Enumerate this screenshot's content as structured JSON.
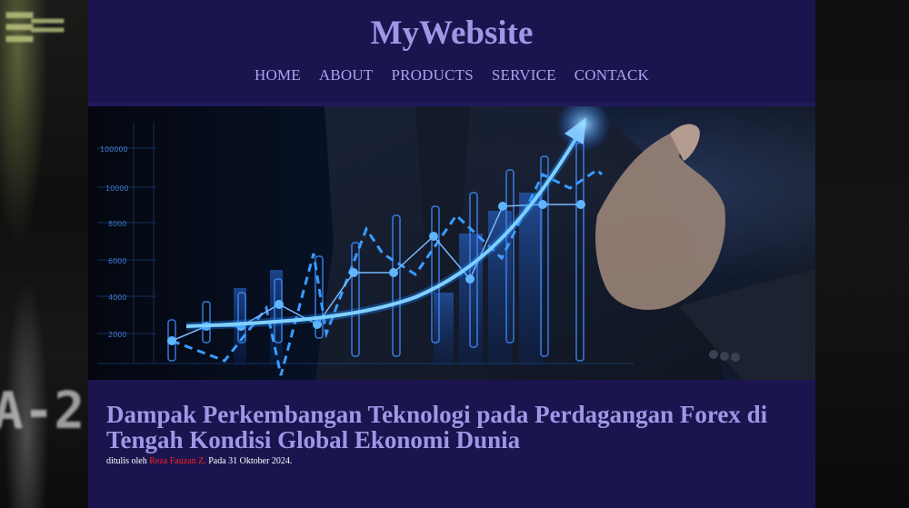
{
  "site": {
    "title": "MyWebsite"
  },
  "nav": {
    "items": [
      {
        "label": "HOME"
      },
      {
        "label": "ABOUT"
      },
      {
        "label": "PRODUCTS"
      },
      {
        "label": "SERVICE"
      },
      {
        "label": "CONTACK"
      }
    ]
  },
  "hero": {
    "description": "Businessman touching glowing rising chart",
    "axis_labels": [
      "100000",
      "10000",
      "8000",
      "6000",
      "4000",
      "2000"
    ]
  },
  "article": {
    "title": "Dampak Perkembangan Teknologi pada Perdagangan Forex di Tengah Kondisi Global Ekonomi Dunia",
    "byline_prefix": "ditulis oleh",
    "author": "Reza Fauzan Z.",
    "byline_suffix": "Pada 31 Oktober 2024."
  },
  "colors": {
    "page_bg": "#1b154f",
    "title": "#9f97e6",
    "nav_link": "#a9a3ef",
    "author": "#ff2020"
  }
}
